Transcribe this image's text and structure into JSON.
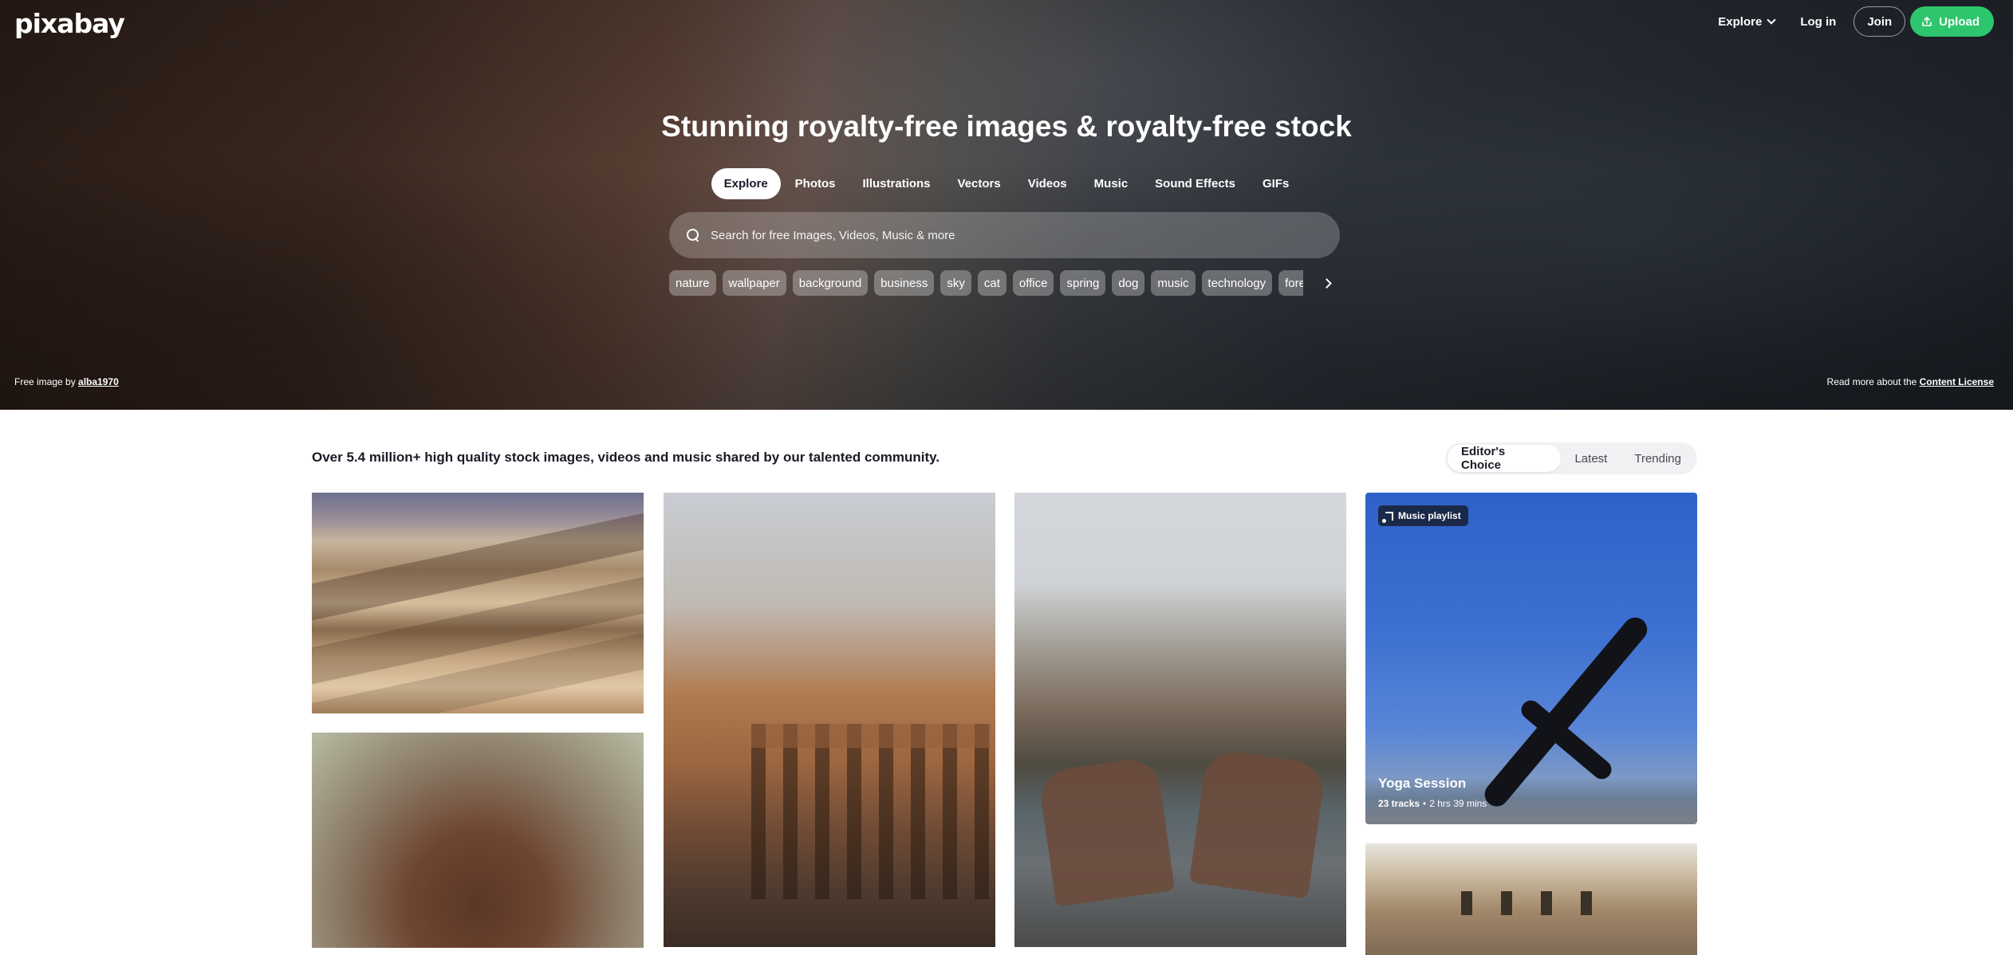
{
  "header": {
    "logo": "pixabay",
    "nav": {
      "explore": "Explore",
      "login": "Log in",
      "join": "Join",
      "upload": "Upload"
    }
  },
  "hero": {
    "title": "Stunning royalty-free images & royalty-free stock",
    "tabs": [
      {
        "label": "Explore",
        "active": true
      },
      {
        "label": "Photos"
      },
      {
        "label": "Illustrations"
      },
      {
        "label": "Vectors"
      },
      {
        "label": "Videos"
      },
      {
        "label": "Music"
      },
      {
        "label": "Sound Effects"
      },
      {
        "label": "GIFs"
      }
    ],
    "search": {
      "placeholder": "Search for free Images, Videos, Music & more",
      "value": ""
    },
    "chips": [
      "nature",
      "wallpaper",
      "background",
      "business",
      "sky",
      "cat",
      "office",
      "spring",
      "dog",
      "music",
      "technology",
      "forest"
    ],
    "credit": {
      "prefix": "Free image by",
      "author": "alba1970"
    },
    "license": {
      "prefix": "Read more about the",
      "link": "Content License"
    }
  },
  "main": {
    "intro": "Over 5.4 million+ high quality stock images, videos and music shared by our talented community.",
    "sort": [
      "Editor's Choice",
      "Latest",
      "Trending"
    ],
    "playlist": {
      "badge": "Music playlist",
      "title": "Yoga Session",
      "tracks": "23 tracks",
      "separator": "•",
      "duration": "2 hrs 39 mins"
    }
  },
  "colors": {
    "accent": "#2ec66d",
    "text": "#191b26",
    "toggle_bg": "#f1f1f4"
  },
  "icons": [
    "chevron-down-icon",
    "upload-icon",
    "search-icon",
    "chevron-right-icon",
    "music-note-icon"
  ]
}
